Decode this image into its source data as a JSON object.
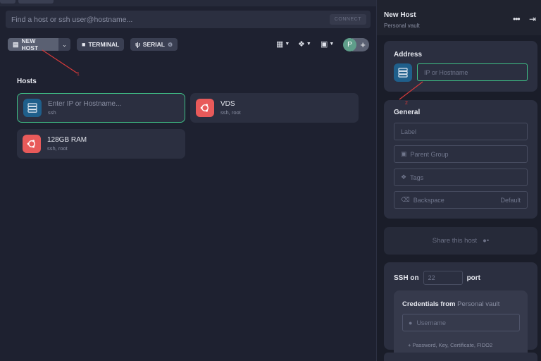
{
  "search": {
    "placeholder": "Find a host or ssh user@hostname...",
    "connect_label": "CONNECT"
  },
  "toolbar": {
    "new_host_label": "NEW HOST",
    "terminal_label": "TERMINAL",
    "serial_label": "SERIAL",
    "avatar_letter": "P"
  },
  "hosts": {
    "title": "Hosts",
    "items": [
      {
        "name": "Enter IP or Hostname...",
        "sub": "ssh",
        "icon": "server-icon"
      },
      {
        "name": "VDS",
        "sub": "ssh, root",
        "icon": "ubuntu-icon"
      },
      {
        "name": "128GB RAM",
        "sub": "ssh, root",
        "icon": "ubuntu-icon"
      }
    ]
  },
  "panel": {
    "title": "New Host",
    "subtitle": "Personal vault",
    "address": {
      "title": "Address",
      "placeholder": "IP or Hostname"
    },
    "general": {
      "title": "General",
      "label_ph": "Label",
      "parent_group_ph": "Parent Group",
      "tags_ph": "Tags",
      "backspace_ph": "Backspace",
      "backspace_value": "Default"
    },
    "share_label": "Share this host",
    "ssh": {
      "ssh_on": "SSH on",
      "port_placeholder": "22",
      "port_label": "port",
      "credentials_from": "Credentials from",
      "credentials_source": "Personal vault",
      "username_ph": "Username",
      "more_label": "Password, Key, Certificate, FIDO2"
    }
  },
  "annotations": {
    "first": "1",
    "second": "2"
  },
  "colors": {
    "accent_green": "#3fbf86",
    "server_blue": "#1f5f8b",
    "ubuntu_red": "#e85a5a",
    "arrow_red": "#d83a3a"
  }
}
